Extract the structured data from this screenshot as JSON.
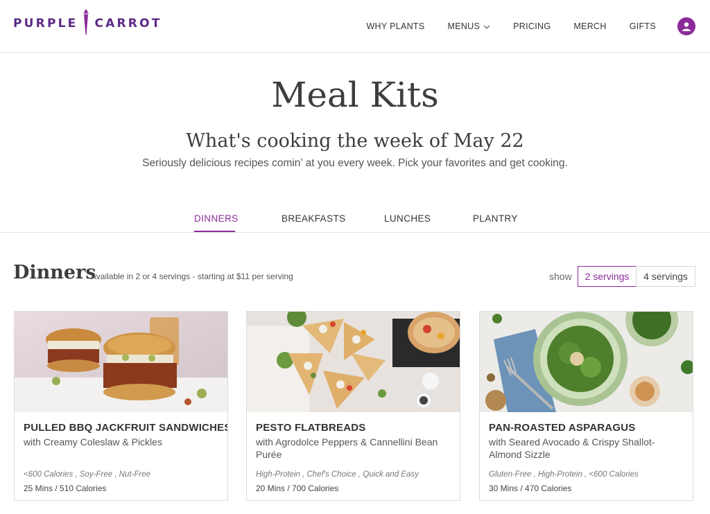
{
  "brand": {
    "name_left": "PURPLE",
    "name_right": "CARROT",
    "color": "#5b2a86",
    "accent": "#8b2b9a"
  },
  "nav": {
    "items": [
      {
        "label": "WHY PLANTS"
      },
      {
        "label": "MENUS"
      },
      {
        "label": "PRICING"
      },
      {
        "label": "MERCH"
      },
      {
        "label": "GIFTS"
      }
    ],
    "account_icon": "user-icon"
  },
  "hero": {
    "title": "Meal Kits",
    "subtitle": "What's cooking the week of May 22",
    "description": "Seriously delicious recipes comin’ at you every week. Pick your favorites and get cooking."
  },
  "tabs": [
    {
      "label": "DINNERS",
      "active": true
    },
    {
      "label": "BREAKFASTS",
      "active": false
    },
    {
      "label": "LUNCHES",
      "active": false
    },
    {
      "label": "PLANTRY",
      "active": false
    }
  ],
  "section": {
    "title": "Dinners",
    "note": "Available in 2 or 4 servings - starting at $11 per serving",
    "show_label": "show",
    "servings": [
      {
        "label": "2 servings",
        "selected": true
      },
      {
        "label": "4 servings",
        "selected": false
      }
    ]
  },
  "cards": [
    {
      "title": "PULLED BBQ JACKFRUIT SANDWICHES",
      "subtitle": "with Creamy Coleslaw & Pickles",
      "tags": "<600 Calories , Soy-Free , Nut-Free",
      "meta": "25 Mins / 510 Calories"
    },
    {
      "title": "PESTO FLATBREADS",
      "subtitle": "with Agrodolce Peppers & Cannellini Bean Purée",
      "tags": "High-Protein , Chef's Choice , Quick and Easy",
      "meta": "20 Mins / 700 Calories"
    },
    {
      "title": "PAN-ROASTED ASPARAGUS",
      "subtitle": "with Seared Avocado & Crispy Shallot-Almond Sizzle",
      "tags": "Gluten-Free , High-Protein , <600 Calories",
      "meta": "30 Mins / 470 Calories"
    }
  ]
}
